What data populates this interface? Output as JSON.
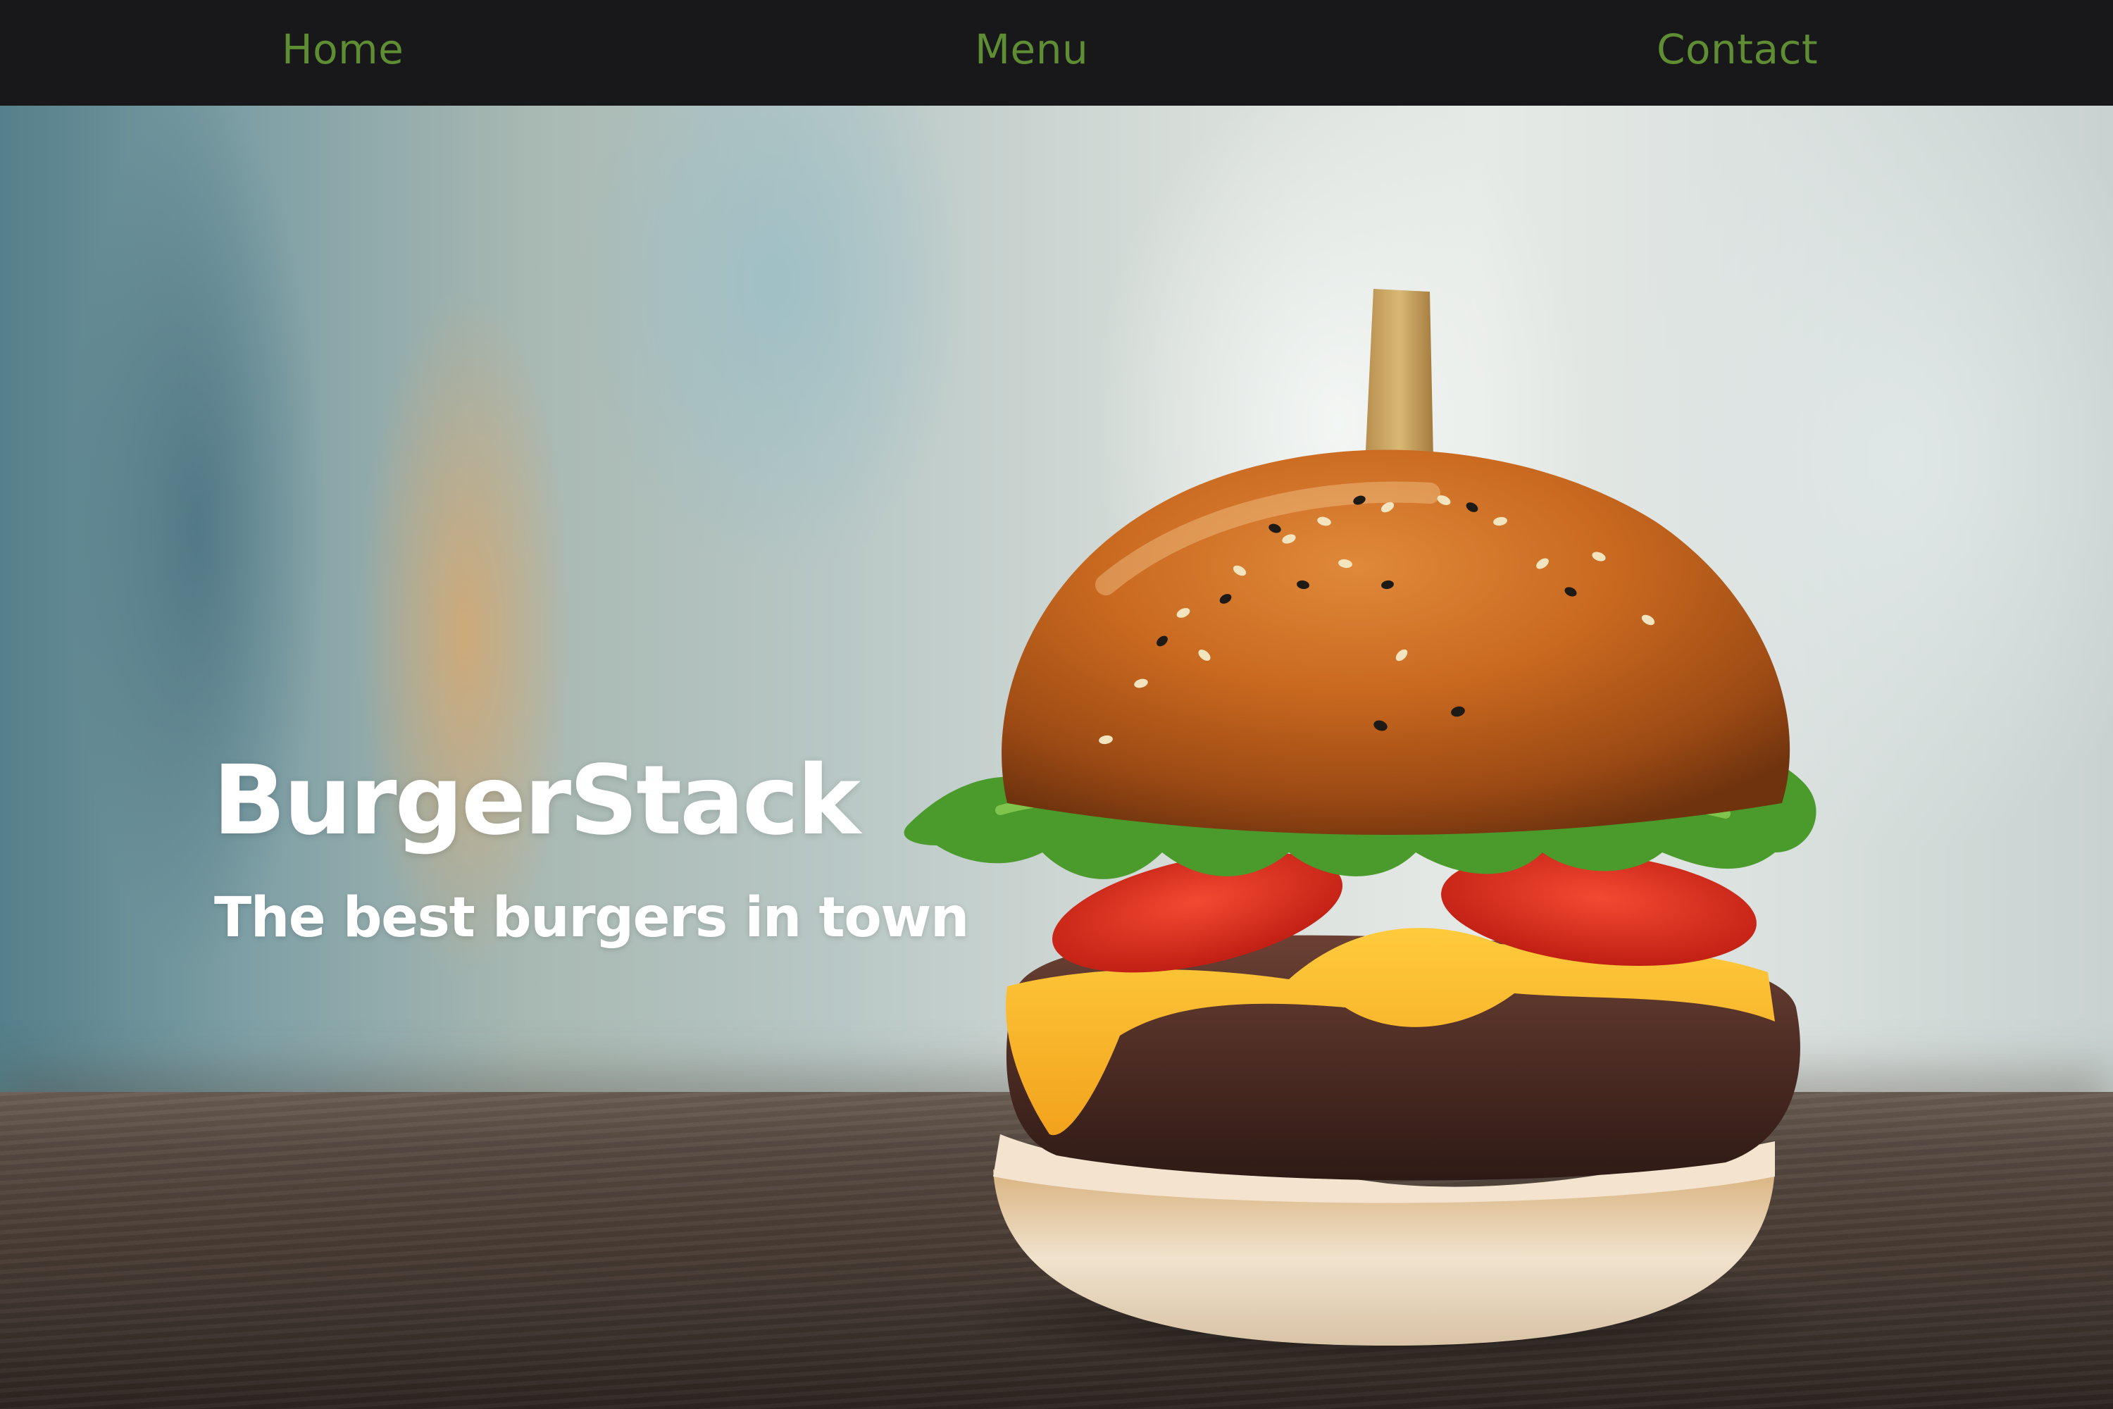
{
  "nav": {
    "home_label": "Home",
    "menu_label": "Menu",
    "contact_label": "Contact",
    "link_color": "#5f8d33",
    "background_color": "#18181a"
  },
  "hero": {
    "title": "BurgerStack",
    "tagline": "The best burgers in town",
    "text_color": "#ffffff",
    "image": "burger-photo"
  }
}
